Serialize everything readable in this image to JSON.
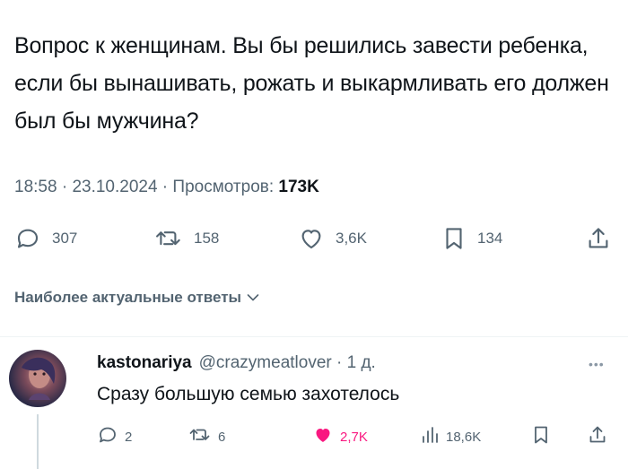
{
  "tweet": {
    "text": "Вопрос к женщинам. Вы бы решились завести ребенка, если бы вынашивать, рожать и выкармливать его должен был бы мужчина?",
    "time": "18:58",
    "date": "23.10.2024",
    "sep1": " · ",
    "sep2": " · ",
    "views_label": "Просмотров: ",
    "views": "173K",
    "actions": {
      "replies": "307",
      "reposts": "158",
      "likes": "3,6K",
      "bookmarks": "134"
    }
  },
  "replies_sort": {
    "label": "Наиболее актуальные ответы"
  },
  "reply": {
    "author": "kastonariya",
    "handle": "@crazymeatlover",
    "sep": " · ",
    "age": "1 д.",
    "more": "•••",
    "text": "Сразу большую семью захотелось",
    "actions": {
      "replies": "2",
      "reposts": "6",
      "likes": "2,7K",
      "views": "18,6K"
    },
    "like_color": "#f91880"
  },
  "colors": {
    "text_primary": "#0f1419",
    "text_secondary": "#536471",
    "divider": "#eff3f4"
  }
}
